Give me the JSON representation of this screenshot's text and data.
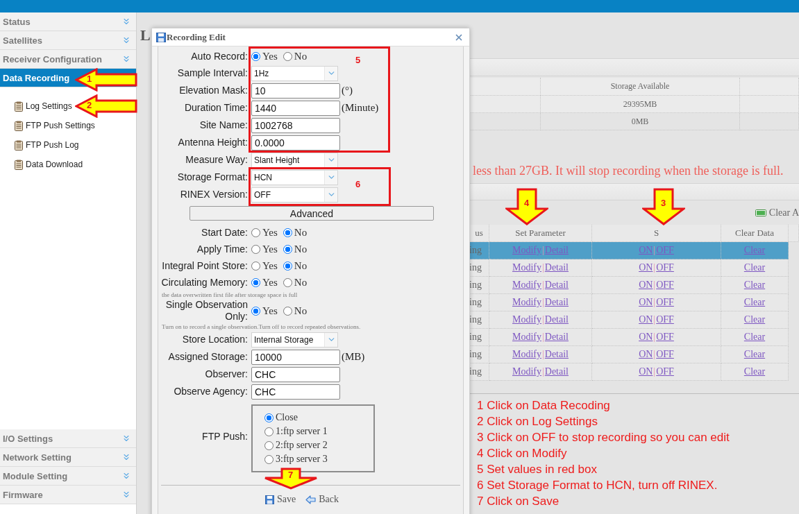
{
  "sidebar": {
    "sections": [
      {
        "label": "Status",
        "selected": false,
        "expanded": false
      },
      {
        "label": "Satellites",
        "selected": false,
        "expanded": false
      },
      {
        "label": "Receiver Configuration",
        "selected": false,
        "expanded": false
      },
      {
        "label": "Data Recording",
        "selected": true,
        "expanded": true,
        "children": [
          {
            "label": "Log Settings"
          },
          {
            "label": "FTP Push Settings"
          },
          {
            "label": "FTP Push Log"
          },
          {
            "label": "Data Download"
          }
        ]
      }
    ],
    "lower_sections": [
      {
        "label": "I/O Settings",
        "selected": false,
        "expanded": false
      },
      {
        "label": "Network Setting",
        "selected": false,
        "expanded": false
      },
      {
        "label": "Module Setting",
        "selected": false,
        "expanded": false
      },
      {
        "label": "Firmware",
        "selected": false,
        "expanded": false
      }
    ]
  },
  "page": {
    "title": "L",
    "storage_table": {
      "header": "Storage Available",
      "rows": [
        "29395MB",
        "0MB"
      ]
    },
    "message": "less than 27GB. It will stop recording when the storage is full.",
    "clear_all": "Clear A",
    "record_table": {
      "columns": [
        "us",
        "Set Parameter",
        "S",
        "Clear Data"
      ],
      "rows": [
        {
          "status": "ing",
          "set_parameter": [
            "Modify",
            "|",
            "Detail"
          ],
          "switch": [
            "ON",
            "|",
            "OFF"
          ],
          "clear_data": "Clear",
          "selected": true
        },
        {
          "status": "ing",
          "set_parameter": [
            "Modify",
            "|",
            "Detail"
          ],
          "switch": [
            "ON",
            "|",
            "OFF"
          ],
          "clear_data": "Clear",
          "selected": false
        },
        {
          "status": "ing",
          "set_parameter": [
            "Modify",
            "|",
            "Detail"
          ],
          "switch": [
            "ON",
            "|",
            "OFF"
          ],
          "clear_data": "Clear",
          "selected": false
        },
        {
          "status": "ing",
          "set_parameter": [
            "Modify",
            "|",
            "Detail"
          ],
          "switch": [
            "ON",
            "|",
            "OFF"
          ],
          "clear_data": "Clear",
          "selected": false
        },
        {
          "status": "ing",
          "set_parameter": [
            "Modify",
            "|",
            "Detail"
          ],
          "switch": [
            "ON",
            "|",
            "OFF"
          ],
          "clear_data": "Clear",
          "selected": false
        },
        {
          "status": "ing",
          "set_parameter": [
            "Modify",
            "|",
            "Detail"
          ],
          "switch": [
            "ON",
            "|",
            "OFF"
          ],
          "clear_data": "Clear",
          "selected": false
        },
        {
          "status": "ing",
          "set_parameter": [
            "Modify",
            "|",
            "Detail"
          ],
          "switch": [
            "ON",
            "|",
            "OFF"
          ],
          "clear_data": "Clear",
          "selected": false
        },
        {
          "status": "ing",
          "set_parameter": [
            "Modify",
            "|",
            "Detail"
          ],
          "switch": [
            "ON",
            "|",
            "OFF"
          ],
          "clear_data": "Clear",
          "selected": false
        }
      ]
    },
    "instructions": [
      "1 Click on Data Recoding",
      "2 Click on Log Settings",
      "3 Click on OFF to stop recording so you can edit",
      "4 Click on Modify",
      "5 Set values in red box",
      "6 Set Storage Format to HCN, turn off RINEX.",
      "7 Click on Save"
    ]
  },
  "dialog": {
    "title": "Recording Edit",
    "fields": [
      {
        "kind": "radio",
        "label": "Auto Record:",
        "options": [
          {
            "label": "Yes",
            "selected": true
          },
          {
            "label": "No",
            "selected": false
          }
        ]
      },
      {
        "kind": "select",
        "label": "Sample Interval:",
        "value": "1Hz"
      },
      {
        "kind": "input",
        "label": "Elevation Mask:",
        "value": "10",
        "unit": "(°)"
      },
      {
        "kind": "input",
        "label": "Duration Time:",
        "value": "1440",
        "unit": "(Minute)"
      },
      {
        "kind": "input",
        "label": "Site Name:",
        "value": "1002768"
      },
      {
        "kind": "input",
        "label": "Antenna Height:",
        "value": "0.0000"
      },
      {
        "kind": "select",
        "label": "Measure Way:",
        "value": "Slant Height"
      },
      {
        "kind": "select",
        "label": "Storage Format:",
        "value": "HCN"
      },
      {
        "kind": "select",
        "label": "RINEX Version:",
        "value": "OFF"
      },
      {
        "kind": "button",
        "label": "Advanced"
      },
      {
        "kind": "radio",
        "label": "Start Date:",
        "options": [
          {
            "label": "Yes",
            "selected": false
          },
          {
            "label": "No",
            "selected": true
          }
        ]
      },
      {
        "kind": "radio",
        "label": "Apply Time:",
        "options": [
          {
            "label": "Yes",
            "selected": false
          },
          {
            "label": "No",
            "selected": true
          }
        ]
      },
      {
        "kind": "radio",
        "label": "Integral Point Store:",
        "options": [
          {
            "label": "Yes",
            "selected": false
          },
          {
            "label": "No",
            "selected": true
          }
        ]
      },
      {
        "kind": "radio",
        "label": "Circulating Memory:",
        "options": [
          {
            "label": "Yes",
            "selected": true
          },
          {
            "label": "No",
            "selected": false
          }
        ]
      },
      {
        "kind": "note",
        "text": "the data overwritten first file after storage space is full"
      },
      {
        "kind": "radio",
        "label": "Single Observation Only:",
        "options": [
          {
            "label": "Yes",
            "selected": true
          },
          {
            "label": "No",
            "selected": false
          }
        ]
      },
      {
        "kind": "note",
        "text": "Turn on to record a single observation.Turn off to record repeated observations."
      },
      {
        "kind": "select",
        "label": "Store Location:",
        "value": "Internal Storage"
      },
      {
        "kind": "input",
        "label": "Assigned Storage:",
        "value": "10000",
        "unit": "(MB)"
      },
      {
        "kind": "input",
        "label": "Observer:",
        "value": "CHC"
      },
      {
        "kind": "input",
        "label": "Observe Agency:",
        "value": "CHC"
      },
      {
        "kind": "radio_box",
        "label": "FTP Push:",
        "options": [
          {
            "label": "Close",
            "selected": true
          },
          {
            "label": "1:ftp server 1",
            "selected": false
          },
          {
            "label": "2:ftp server 2",
            "selected": false
          },
          {
            "label": "3:ftp server 3",
            "selected": false
          }
        ]
      }
    ],
    "buttons": [
      "Save",
      "Back"
    ]
  },
  "annotations": {
    "arrows": [
      {
        "number": "1",
        "kind": "left"
      },
      {
        "number": "2",
        "kind": "left"
      },
      {
        "number": "4",
        "kind": "down"
      },
      {
        "number": "3",
        "kind": "down"
      },
      {
        "number": "7",
        "kind": "down"
      }
    ],
    "boxes": [
      {
        "number": "5"
      },
      {
        "number": "6"
      }
    ]
  }
}
